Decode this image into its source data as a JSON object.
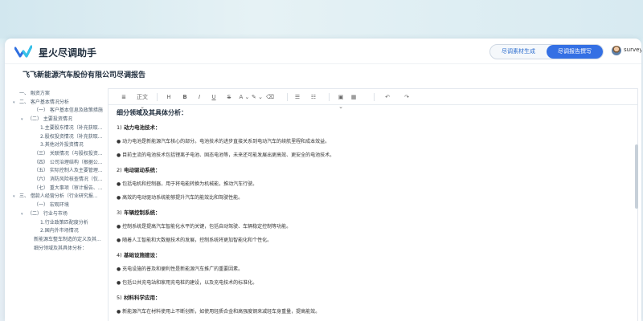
{
  "header": {
    "app_title": "星火尽调助手",
    "mode_tabs": [
      "尽调素材生成",
      "尽调报告撰写"
    ],
    "active_mode": 1,
    "user_name": "survey",
    "user_chevron": "∨"
  },
  "doc_title": "飞飞新能源汽车股份有限公司尽调报告",
  "sidebar": {
    "items": [
      {
        "label": "一、 融资方案",
        "arrow": ""
      },
      {
        "label": "二、 客户基本情况分析",
        "arrow": "▾"
      },
      {
        "label": "（一） 客户基本信息及政策措施",
        "arrow": ""
      },
      {
        "label": "（二） 主要投资情况",
        "arrow": "▾"
      },
      {
        "label": "1.主要股东情况（补充获取...",
        "arrow": ""
      },
      {
        "label": "2.股权投资情况（补充获取...",
        "arrow": ""
      },
      {
        "label": "3.其他对外投资情况",
        "arrow": ""
      },
      {
        "label": "（三） 关联情况（与股权投资...",
        "arrow": ""
      },
      {
        "label": "（四） 公司治理结构（根据公...",
        "arrow": ""
      },
      {
        "label": "（五） 实际控制人及主要管理...",
        "arrow": ""
      },
      {
        "label": "（六） 消防风险核查情况（仅...",
        "arrow": ""
      },
      {
        "label": "（七） 重大事项（审计报告、...",
        "arrow": ""
      },
      {
        "label": "三、 借款人经营分析（行业研究报...",
        "arrow": "▾"
      },
      {
        "label": "（一） 宏观环境",
        "arrow": ""
      },
      {
        "label": "（二） 行业与市场",
        "arrow": "▾"
      },
      {
        "label": "1.行业政策匹配度分析",
        "arrow": ""
      },
      {
        "label": "2.国内外市场情况",
        "arrow": ""
      },
      {
        "label": "新能源车整车制造的定义及其...",
        "arrow": ""
      },
      {
        "label": "细分领域及其具体分析：",
        "arrow": ""
      }
    ]
  },
  "toolbar": {
    "buttons": [
      {
        "name": "format-icon",
        "glyph": "≣"
      },
      {
        "name": "text-style-dropdown",
        "glyph": "正文 ⌄"
      },
      {
        "name": "heading-icon",
        "glyph": "H"
      },
      {
        "name": "bold-icon",
        "glyph": "B"
      },
      {
        "name": "italic-icon",
        "glyph": "I"
      },
      {
        "name": "underline-icon",
        "glyph": "U"
      },
      {
        "name": "strikethrough-icon",
        "glyph": "S"
      },
      {
        "name": "text-color-icon",
        "glyph": "A ⌄"
      },
      {
        "name": "highlight-icon",
        "glyph": "✎ ⌄"
      },
      {
        "name": "eraser-icon",
        "glyph": "⌫"
      },
      {
        "name": "ordered-list-icon",
        "glyph": "☰"
      },
      {
        "name": "unordered-list-icon",
        "glyph": "☷"
      },
      {
        "name": "image-icon",
        "glyph": "▣ ⌄"
      },
      {
        "name": "table-icon",
        "glyph": "▦"
      },
      {
        "name": "undo-icon",
        "glyph": "↶"
      },
      {
        "name": "redo-icon",
        "glyph": "↷"
      }
    ]
  },
  "content": {
    "lines": [
      {
        "type": "title",
        "text": "细分领域及其具体分析："
      },
      {
        "type": "sub",
        "num": "1)",
        "text": "动力电池技术："
      },
      {
        "type": "p",
        "text": "● 动力电池是新能源汽车核心的部分。电池技术的进步直接关系到电动汽车的续航里程和成本效益。"
      },
      {
        "type": "p",
        "text": "● 目前主流的电池技术包括锂离子电池、固态电池等，未来还可能发展出更高效、更安全的电池技术。"
      },
      {
        "type": "sub",
        "num": "2)",
        "text": "电动驱动系统："
      },
      {
        "type": "p",
        "text": "● 包括电机和控制器，用于将电能转换为机械能，推动汽车行驶。"
      },
      {
        "type": "p",
        "text": "● 高效的电动驱动系统能够提升汽车的能效比和驾驶性能。"
      },
      {
        "type": "sub",
        "num": "3)",
        "text": "车辆控制系统："
      },
      {
        "type": "p",
        "text": "● 控制系统是提高汽车智能化水平的关键，包括自动驾驶、车辆稳定控制等功能。"
      },
      {
        "type": "p",
        "text": "● 随着人工智能和大数据技术的发展，控制系统将更加智能化和个性化。"
      },
      {
        "type": "sub",
        "num": "4)",
        "text": "基础设施建设："
      },
      {
        "type": "p",
        "text": "● 充电设施的普及和便利性是新能源汽车推广的重要因素。"
      },
      {
        "type": "p",
        "text": "● 包括公共充电站和家用充电桩的建设，以及充电技术的标准化。"
      },
      {
        "type": "sub",
        "num": "5)",
        "text": "材料科学应用："
      },
      {
        "type": "p",
        "text": "● 新能源汽车在材料使用上不断创新，如使用轻质合金和高强度钢来减轻车身重量，提高能效。"
      }
    ]
  }
}
